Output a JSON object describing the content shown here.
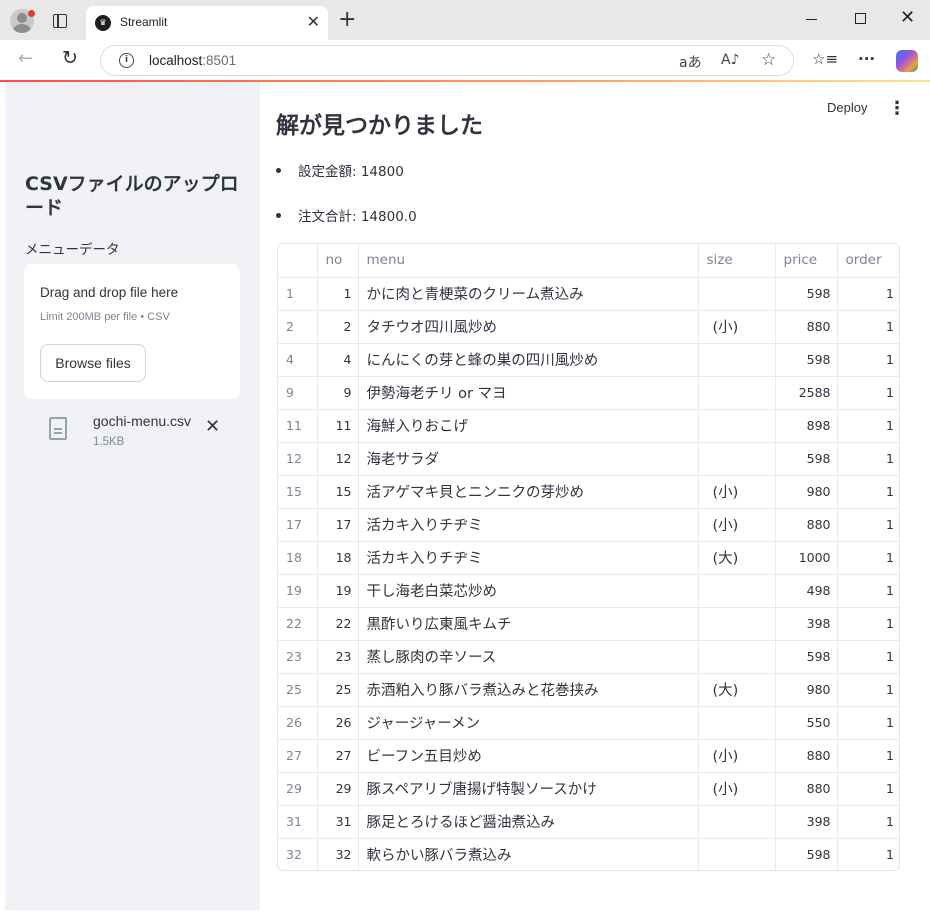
{
  "browser": {
    "tab_title": "Streamlit",
    "url_host": "localhost",
    "url_port": ":8501",
    "accent": "#ff4b4b"
  },
  "sidebar": {
    "title": "CSVファイルのアップロード",
    "uploader_label": "メニューデータ",
    "dropzone_title": "Drag and drop file here",
    "dropzone_limit": "Limit 200MB per file • CSV",
    "browse_label": "Browse files",
    "file_name": "gochi-menu.csv",
    "file_size": "1.5KB"
  },
  "header": {
    "deploy_label": "Deploy"
  },
  "main": {
    "title": "解が見つかりました",
    "bullets": [
      {
        "label": "設定金額",
        "value": "14800"
      },
      {
        "label": "注文合計",
        "value": "14800.0"
      }
    ]
  },
  "table": {
    "columns": [
      "",
      "no",
      "menu",
      "size",
      "price",
      "order"
    ],
    "rows": [
      {
        "idx": "1",
        "no": "1",
        "menu": "かに肉と青梗菜のクリーム煮込み",
        "size": "",
        "price": "598",
        "order": "1"
      },
      {
        "idx": "2",
        "no": "2",
        "menu": "タチウオ四川風炒め",
        "size": "(小)",
        "price": "880",
        "order": "1"
      },
      {
        "idx": "4",
        "no": "4",
        "menu": "にんにくの芽と蜂の巣の四川風炒め",
        "size": "",
        "price": "598",
        "order": "1"
      },
      {
        "idx": "9",
        "no": "9",
        "menu": "伊勢海老チリ or マヨ",
        "size": "",
        "price": "2588",
        "order": "1"
      },
      {
        "idx": "11",
        "no": "11",
        "menu": "海鮮入りおこげ",
        "size": "",
        "price": "898",
        "order": "1"
      },
      {
        "idx": "12",
        "no": "12",
        "menu": "海老サラダ",
        "size": "",
        "price": "598",
        "order": "1"
      },
      {
        "idx": "15",
        "no": "15",
        "menu": "活アゲマキ貝とニンニクの芽炒め",
        "size": "(小)",
        "price": "980",
        "order": "1"
      },
      {
        "idx": "17",
        "no": "17",
        "menu": "活カキ入りチヂミ",
        "size": "(小)",
        "price": "880",
        "order": "1"
      },
      {
        "idx": "18",
        "no": "18",
        "menu": "活カキ入りチヂミ",
        "size": "(大)",
        "price": "1000",
        "order": "1"
      },
      {
        "idx": "19",
        "no": "19",
        "menu": "干し海老白菜芯炒め",
        "size": "",
        "price": "498",
        "order": "1"
      },
      {
        "idx": "22",
        "no": "22",
        "menu": "黒酢いり広東風キムチ",
        "size": "",
        "price": "398",
        "order": "1"
      },
      {
        "idx": "23",
        "no": "23",
        "menu": "蒸し豚肉の辛ソース",
        "size": "",
        "price": "598",
        "order": "1"
      },
      {
        "idx": "25",
        "no": "25",
        "menu": "赤酒粕入り豚バラ煮込みと花巻挟み",
        "size": "(大)",
        "price": "980",
        "order": "1"
      },
      {
        "idx": "26",
        "no": "26",
        "menu": "ジャージャーメン",
        "size": "",
        "price": "550",
        "order": "1"
      },
      {
        "idx": "27",
        "no": "27",
        "menu": "ビーフン五目炒め",
        "size": "(小)",
        "price": "880",
        "order": "1"
      },
      {
        "idx": "29",
        "no": "29",
        "menu": "豚スペアリブ唐揚げ特製ソースかけ",
        "size": "(小)",
        "price": "880",
        "order": "1"
      },
      {
        "idx": "31",
        "no": "31",
        "menu": "豚足とろけるほど醤油煮込み",
        "size": "",
        "price": "398",
        "order": "1"
      },
      {
        "idx": "32",
        "no": "32",
        "menu": "軟らかい豚バラ煮込み",
        "size": "",
        "price": "598",
        "order": "1"
      }
    ]
  }
}
